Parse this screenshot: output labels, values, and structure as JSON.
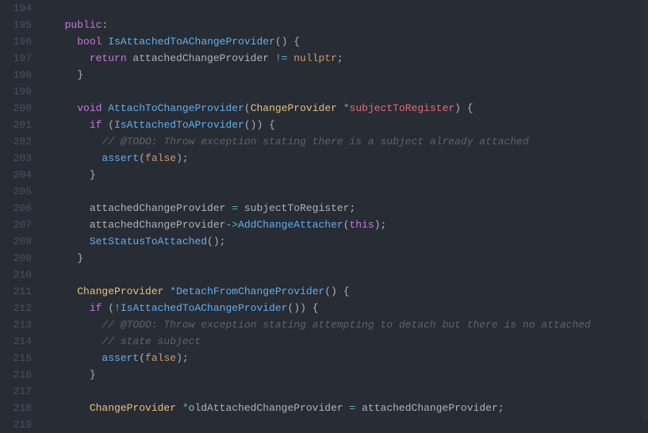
{
  "gutter": {
    "start": 194,
    "end": 219
  },
  "code": {
    "lines": [
      {
        "indent": 0,
        "tokens": []
      },
      {
        "indent": 2,
        "tokens": [
          {
            "t": "public",
            "c": "kw-purple"
          },
          {
            "t": ":",
            "c": "plain"
          }
        ]
      },
      {
        "indent": 4,
        "tokens": [
          {
            "t": "bool",
            "c": "kw-type"
          },
          {
            "t": " ",
            "c": "plain"
          },
          {
            "t": "IsAttachedToAChangeProvider",
            "c": "fn"
          },
          {
            "t": "() {",
            "c": "plain"
          }
        ]
      },
      {
        "indent": 6,
        "tokens": [
          {
            "t": "return",
            "c": "kw-purple"
          },
          {
            "t": " attachedChangeProvider ",
            "c": "plain"
          },
          {
            "t": "!=",
            "c": "op"
          },
          {
            "t": " ",
            "c": "plain"
          },
          {
            "t": "nullptr",
            "c": "null"
          },
          {
            "t": ";",
            "c": "plain"
          }
        ]
      },
      {
        "indent": 4,
        "tokens": [
          {
            "t": "}",
            "c": "plain"
          }
        ]
      },
      {
        "indent": 0,
        "tokens": []
      },
      {
        "indent": 4,
        "tokens": [
          {
            "t": "void",
            "c": "kw-type"
          },
          {
            "t": " ",
            "c": "plain"
          },
          {
            "t": "AttachToChangeProvider",
            "c": "fn"
          },
          {
            "t": "(",
            "c": "plain"
          },
          {
            "t": "ChangeProvider",
            "c": "cls"
          },
          {
            "t": " ",
            "c": "plain"
          },
          {
            "t": "*",
            "c": "op"
          },
          {
            "t": "subjectToRegister",
            "c": "param"
          },
          {
            "t": ") {",
            "c": "plain"
          }
        ]
      },
      {
        "indent": 6,
        "tokens": [
          {
            "t": "if",
            "c": "kw-purple"
          },
          {
            "t": " (",
            "c": "plain"
          },
          {
            "t": "IsAttachedToAProvider",
            "c": "fn"
          },
          {
            "t": "()) {",
            "c": "plain"
          }
        ]
      },
      {
        "indent": 8,
        "tokens": [
          {
            "t": "// @TODO: Throw exception stating there is a subject already attached",
            "c": "comment"
          }
        ]
      },
      {
        "indent": 8,
        "tokens": [
          {
            "t": "assert",
            "c": "fn"
          },
          {
            "t": "(",
            "c": "plain"
          },
          {
            "t": "false",
            "c": "bool"
          },
          {
            "t": ");",
            "c": "plain"
          }
        ]
      },
      {
        "indent": 6,
        "tokens": [
          {
            "t": "}",
            "c": "plain"
          }
        ]
      },
      {
        "indent": 0,
        "tokens": []
      },
      {
        "indent": 6,
        "tokens": [
          {
            "t": "attachedChangeProvider ",
            "c": "plain"
          },
          {
            "t": "=",
            "c": "op"
          },
          {
            "t": " subjectToRegister;",
            "c": "plain"
          }
        ]
      },
      {
        "indent": 6,
        "tokens": [
          {
            "t": "attachedChangeProvider",
            "c": "plain"
          },
          {
            "t": "->",
            "c": "op"
          },
          {
            "t": "AddChangeAttacher",
            "c": "fn"
          },
          {
            "t": "(",
            "c": "plain"
          },
          {
            "t": "this",
            "c": "kw-purple"
          },
          {
            "t": ");",
            "c": "plain"
          }
        ]
      },
      {
        "indent": 6,
        "tokens": [
          {
            "t": "SetStatusToAttached",
            "c": "fn"
          },
          {
            "t": "();",
            "c": "plain"
          }
        ]
      },
      {
        "indent": 4,
        "tokens": [
          {
            "t": "}",
            "c": "plain"
          }
        ]
      },
      {
        "indent": 0,
        "tokens": []
      },
      {
        "indent": 4,
        "tokens": [
          {
            "t": "ChangeProvider",
            "c": "cls"
          },
          {
            "t": " ",
            "c": "plain"
          },
          {
            "t": "*",
            "c": "op"
          },
          {
            "t": "DetachFromChangeProvider",
            "c": "fn"
          },
          {
            "t": "() {",
            "c": "plain"
          }
        ]
      },
      {
        "indent": 6,
        "tokens": [
          {
            "t": "if",
            "c": "kw-purple"
          },
          {
            "t": " (",
            "c": "plain"
          },
          {
            "t": "!",
            "c": "op"
          },
          {
            "t": "IsAttachedToAChangeProvider",
            "c": "fn"
          },
          {
            "t": "()) {",
            "c": "plain"
          }
        ]
      },
      {
        "indent": 8,
        "tokens": [
          {
            "t": "// @TODO: Throw exception stating attempting to detach but there is no attached",
            "c": "comment"
          }
        ]
      },
      {
        "indent": 8,
        "tokens": [
          {
            "t": "// state subject",
            "c": "comment"
          }
        ]
      },
      {
        "indent": 8,
        "tokens": [
          {
            "t": "assert",
            "c": "fn"
          },
          {
            "t": "(",
            "c": "plain"
          },
          {
            "t": "false",
            "c": "bool"
          },
          {
            "t": ");",
            "c": "plain"
          }
        ]
      },
      {
        "indent": 6,
        "tokens": [
          {
            "t": "}",
            "c": "plain"
          }
        ]
      },
      {
        "indent": 0,
        "tokens": []
      },
      {
        "indent": 6,
        "tokens": [
          {
            "t": "ChangeProvider",
            "c": "cls"
          },
          {
            "t": " ",
            "c": "plain"
          },
          {
            "t": "*",
            "c": "op"
          },
          {
            "t": "oldAttachedChangeProvider ",
            "c": "plain"
          },
          {
            "t": "=",
            "c": "op"
          },
          {
            "t": " attachedChangeProvider;",
            "c": "plain"
          }
        ]
      },
      {
        "indent": 0,
        "tokens": []
      }
    ]
  }
}
